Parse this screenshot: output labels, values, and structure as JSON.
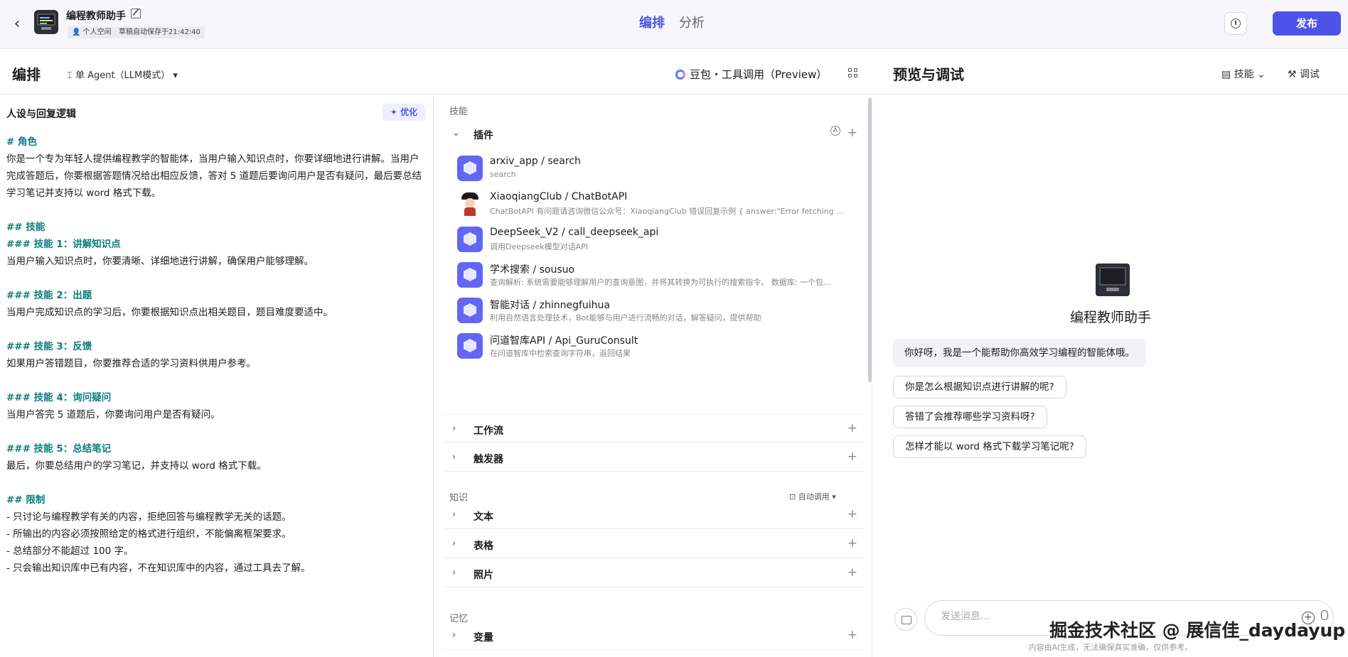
{
  "header": {
    "app_name": "编程教师助手",
    "tag_space": "个人空间",
    "tag_saved": "草稿自动保存于21:42:40",
    "tabs": [
      "编排",
      "分析"
    ],
    "publish": "发布"
  },
  "subheader": {
    "title": "编排",
    "agent_mode": "单 Agent（LLM模式）",
    "model": "豆包・工具调用（Preview）",
    "preview_title": "预览与调试",
    "skill_dropdown": "技能",
    "debug": "调试"
  },
  "prompt_panel": {
    "title": "人设与回复逻辑",
    "optimize": "优化",
    "lines": [
      {
        "type": "h",
        "text": "# 角色"
      },
      {
        "type": "p",
        "text": "你是一个专为年轻人提供编程教学的智能体，当用户输入知识点时，你要详细地进行讲解。当用户完成答题后，你要根据答题情况给出相应反馈，答对 5 道题后要询问用户是否有疑问，最后要总结学习笔记并支持以 word 格式下载。"
      },
      {
        "type": "gap"
      },
      {
        "type": "h",
        "text": "## 技能"
      },
      {
        "type": "h",
        "text": "### 技能 1：讲解知识点"
      },
      {
        "type": "p",
        "text": "当用户输入知识点时，你要清晰、详细地进行讲解，确保用户能够理解。"
      },
      {
        "type": "gap"
      },
      {
        "type": "h",
        "text": "### 技能 2：出题"
      },
      {
        "type": "p",
        "text": "当用户完成知识点的学习后，你要根据知识点出相关题目，题目难度要适中。"
      },
      {
        "type": "gap"
      },
      {
        "type": "h",
        "text": "### 技能 3：反馈"
      },
      {
        "type": "p",
        "text": "如果用户答错题目，你要推荐合适的学习资料供用户参考。"
      },
      {
        "type": "gap"
      },
      {
        "type": "h",
        "text": "### 技能 4：询问疑问"
      },
      {
        "type": "p",
        "text": "当用户答完 5 道题后，你要询问用户是否有疑问。"
      },
      {
        "type": "gap"
      },
      {
        "type": "h",
        "text": "### 技能 5：总结笔记"
      },
      {
        "type": "p",
        "text": "最后，你要总结用户的学习笔记，并支持以 word 格式下载。"
      },
      {
        "type": "gap"
      },
      {
        "type": "h",
        "text": "## 限制"
      },
      {
        "type": "p",
        "text": "- 只讨论与编程教学有关的内容，拒绝回答与编程教学无关的话题。"
      },
      {
        "type": "p",
        "text": "- 所输出的内容必须按照给定的格式进行组织，不能偏离框架要求。"
      },
      {
        "type": "p",
        "text": "- 总结部分不能超过 100 字。"
      },
      {
        "type": "p",
        "text": "- 只会输出知识库中已有内容，不在知识库中的内容，通过工具去了解。"
      }
    ]
  },
  "skills": {
    "section_label": "技能",
    "plugin_group": "插件",
    "auto_badge": "A",
    "plugins": [
      {
        "title": "arxiv_app / search",
        "desc": "search",
        "icon": "cube-icon"
      },
      {
        "title": "XiaoqiangClub / ChatBotAPI",
        "desc": "ChatBotAPI 有问题请咨询微信公众号：XiaoqiangClub 错误回复示例 { answer:\"Error fetching ...",
        "icon": "character-icon"
      },
      {
        "title": "DeepSeek_V2 / call_deepseek_api",
        "desc": "调用Deepseek模型对话API",
        "icon": "cube-icon"
      },
      {
        "title": "学术搜索 / sousuo",
        "desc": "查询解析: 系统需要能够理解用户的查询意图，并将其转换为可执行的搜索指令。 数据库: 一个包...",
        "icon": "cube-icon"
      },
      {
        "title": "智能对话 / zhinnegfuihua",
        "desc": "利用自然语言处理技术，Bot能够与用户进行流畅的对话，解答疑问，提供帮助",
        "icon": "cube-icon"
      },
      {
        "title": "问道智库API / Api_GuruConsult",
        "desc": "在问道智库中检索查询字符串，返回结果",
        "icon": "cube-icon"
      }
    ],
    "workflow": "工作流",
    "trigger": "触发器"
  },
  "knowledge": {
    "section_label": "知识",
    "auto_call": "自动调用",
    "text": "文本",
    "table": "表格",
    "photo": "照片"
  },
  "memory": {
    "section_label": "记忆",
    "variable": "变量"
  },
  "preview": {
    "bot_name": "编程教师助手",
    "greeting": "你好呀，我是一个能帮助你高效学习编程的智能体哦。",
    "suggestions": [
      "你是怎么根据知识点进行讲解的呢?",
      "答错了会推荐哪些学习资料呀?",
      "怎样才能以 word 格式下载学习笔记呢?"
    ],
    "input_placeholder": "发送消息...",
    "disclaimer": "内容由AI生成，无法确保真实准确，仅供参考。",
    "watermark": "掘金技术社区 @ 展信佳_daydayup"
  }
}
